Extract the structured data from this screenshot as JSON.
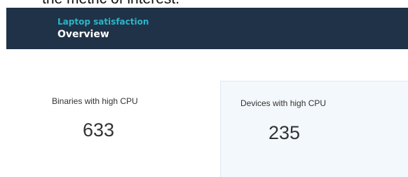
{
  "top_caption": "the metric of interest.",
  "banner": {
    "eyebrow": "Laptop satisfaction",
    "title": "Overview"
  },
  "kpis": [
    {
      "label": "Binaries with high CPU",
      "value": "633"
    },
    {
      "label": "Devices with high CPU",
      "value": "235"
    }
  ]
}
